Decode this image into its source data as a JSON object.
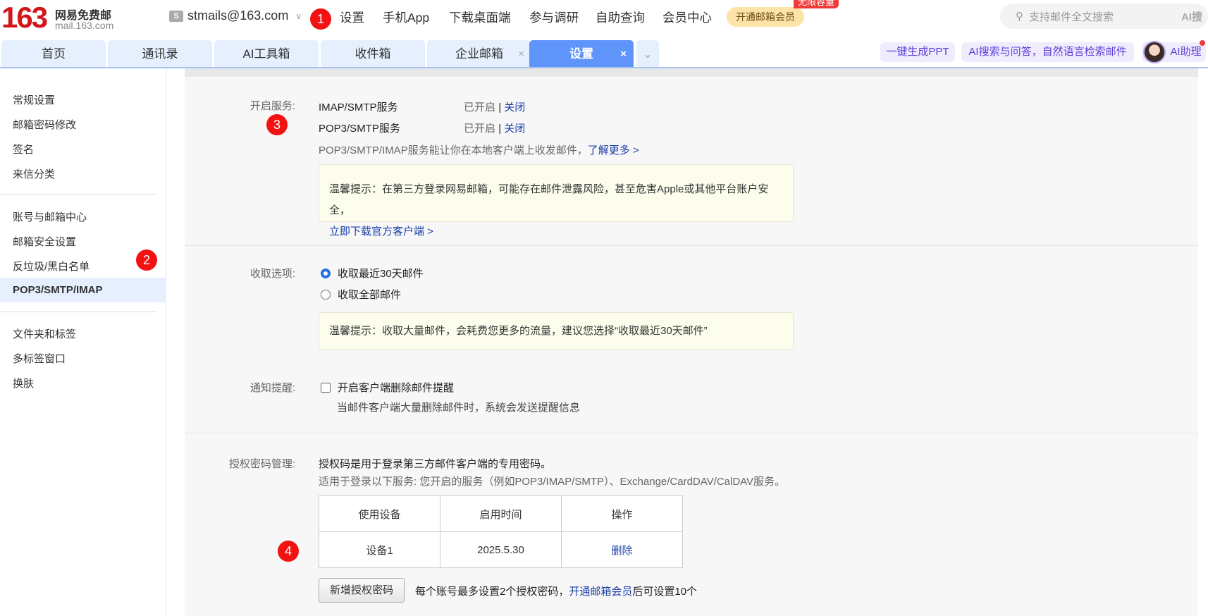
{
  "header": {
    "logo_num": "163",
    "logo_title": "网易免费邮",
    "logo_domain": "mail.163.com",
    "account": "stmails@163.com",
    "nav": [
      "设置",
      "手机App",
      "下载桌面端",
      "参与调研",
      "自助查询",
      "会员中心"
    ],
    "vip_button": "开通邮箱会员",
    "vip_badge": "无限容量",
    "search_placeholder": "支持邮件全文搜索",
    "search_ai": "AI搜"
  },
  "tabs": [
    {
      "label": "首页"
    },
    {
      "label": "通讯录"
    },
    {
      "label": "AI工具箱"
    },
    {
      "label": "收件箱"
    },
    {
      "label": "企业邮箱",
      "close": "×"
    },
    {
      "label": "设置",
      "close": "×"
    }
  ],
  "tab_more": "⌄",
  "ai_pills": {
    "ppt": "一键生成PPT",
    "search": "AI搜索与问答，自然语言检索邮件",
    "assistant": "AI助理"
  },
  "sidebar": {
    "group1": [
      "常规设置",
      "邮箱密码修改",
      "签名",
      "来信分类"
    ],
    "group2": [
      "账号与邮箱中心",
      "邮箱安全设置",
      "反垃圾/黑白名单",
      "POP3/SMTP/IMAP"
    ],
    "group3": [
      "文件夹和标签",
      "多标签窗口",
      "换肤"
    ]
  },
  "services": {
    "label": "开启服务:",
    "rows": [
      {
        "name": "IMAP/SMTP服务",
        "status": "已开启",
        "sep": "|",
        "action": "关闭"
      },
      {
        "name": "POP3/SMTP服务",
        "status": "已开启",
        "sep": "|",
        "action": "关闭"
      }
    ],
    "desc": "POP3/SMTP/IMAP服务能让你在本地客户端上收发邮件，",
    "learn_more": "了解更多 >",
    "tip": "温馨提示：在第三方登录网易邮箱，可能存在邮件泄露风险，甚至危害Apple或其他平台账户安全，",
    "tip_link": "立即下载官方客户端 >"
  },
  "fetch": {
    "label": "收取选项:",
    "options": [
      "收取最近30天邮件",
      "收取全部邮件"
    ],
    "selected": 0,
    "tip": "温馨提示：收取大量邮件，会耗费您更多的流量，建议您选择“收取最近30天邮件”"
  },
  "notify": {
    "label": "通知提醒:",
    "option": "开启客户端删除邮件提醒",
    "checked": false,
    "desc": "当邮件客户端大量删除邮件时，系统会发送提醒信息"
  },
  "auth": {
    "label": "授权密码管理:",
    "line1": "授权码是用于登录第三方邮件客户端的专用密码。",
    "line2": "适用于登录以下服务: 您开启的服务（例如POP3/IMAP/SMTP）、Exchange/CardDAV/CalDAV服务。",
    "columns": [
      "使用设备",
      "启用时间",
      "操作"
    ],
    "rows": [
      {
        "device": "设备1",
        "date": "2025.5.30",
        "action": "删除"
      }
    ],
    "add_button": "新增授权密码",
    "limit_text": "每个账号最多设置2个授权密码，",
    "limit_link": "开通邮箱会员",
    "limit_suffix": "后可设置10个"
  },
  "markers": [
    "1",
    "2",
    "3",
    "4"
  ]
}
